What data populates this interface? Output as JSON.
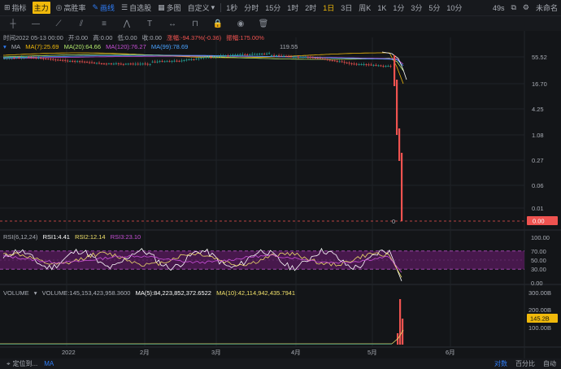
{
  "toolbar": {
    "items": [
      {
        "label": "指标",
        "icon": "indicator-icon",
        "style": "normal"
      },
      {
        "label": "主力",
        "icon": "",
        "style": "pill"
      },
      {
        "label": "高胜率",
        "icon": "target-icon",
        "style": "normal"
      },
      {
        "label": "画线",
        "icon": "pen-icon",
        "style": "active"
      },
      {
        "label": "自选股",
        "icon": "list-icon",
        "style": "normal"
      },
      {
        "label": "多图",
        "icon": "grid-icon",
        "style": "normal"
      },
      {
        "label": "自定义",
        "icon": "",
        "style": "dropdown"
      }
    ],
    "timeframes": [
      {
        "label": "1秒",
        "active": false
      },
      {
        "label": "分时",
        "active": false
      },
      {
        "label": "15分",
        "active": false
      },
      {
        "label": "1时",
        "active": false
      },
      {
        "label": "2时",
        "active": false
      },
      {
        "label": "1日",
        "active": true
      },
      {
        "label": "3日",
        "active": false
      },
      {
        "label": "周K",
        "active": false
      },
      {
        "label": "1K",
        "active": false
      },
      {
        "label": "1分",
        "active": false
      },
      {
        "label": "3分",
        "active": false
      },
      {
        "label": "5分",
        "active": false
      },
      {
        "label": "10分",
        "active": false
      }
    ],
    "right": {
      "countdown": "49s",
      "user": "未命名"
    }
  },
  "info_line": {
    "time": "时间2022 05-13 00:00",
    "open": "开:0.00",
    "high": "高:0.00",
    "low": "低:0.00",
    "close": "收:0.00",
    "change": "涨幅:-94.37%(-0.36)",
    "amplitude": "振幅:175.00%"
  },
  "ma_line": {
    "label": "MA",
    "ma7": "MA(7):25.69",
    "ma20": "MA(20):64.66",
    "ma120": "MA(120):76.27",
    "ma99": "MA(99):78.69"
  },
  "price_axis": {
    "ticks": [
      "55.52",
      "16.70",
      "4.25",
      "1.08",
      "0.27",
      "0.06",
      "0.01"
    ],
    "current": "0.00",
    "peak_label": "119.55",
    "zero_label": "0"
  },
  "rsi": {
    "label": "RSI(6,12,24)",
    "rsi1": "RSI1:4.41",
    "rsi2": "RSI2:12.14",
    "rsi3": "RSI3:23.10",
    "ticks": [
      "100.00",
      "70.00",
      "50.00",
      "30.00",
      "0.00"
    ]
  },
  "volume": {
    "label": "VOLUME",
    "value": "VOLUME:145,153,423,958.3600",
    "ma5": "MA(5):84,223,852,372.6522",
    "ma10": "MA(10):42,114,942,435.7941",
    "ticks": [
      "300.00B",
      "200.00B",
      "100.00B"
    ],
    "current": "145.2B"
  },
  "time_axis": [
    "2022",
    "2月",
    "3月",
    "4月",
    "5月",
    "6月"
  ],
  "bottombar": {
    "items": [
      {
        "label": "定位到...",
        "icon": "locate-icon",
        "active": false
      },
      {
        "label": "MA",
        "icon": "",
        "active": true
      }
    ],
    "right": [
      {
        "label": "对数",
        "active": true
      },
      {
        "label": "百分比",
        "active": false
      },
      {
        "label": "自动",
        "active": false
      }
    ]
  },
  "colors": {
    "up": "#26a69a",
    "down": "#ef5350",
    "ma7": "#f0b90b",
    "ma20": "#b2e86b",
    "ma120": "#c94fd8",
    "ma99": "#4aa3ff",
    "rsi1": "#ffffff",
    "rsi2": "#f0e06a",
    "rsi3": "#c94fd8",
    "rsi_band": "#5a1a5e"
  }
}
